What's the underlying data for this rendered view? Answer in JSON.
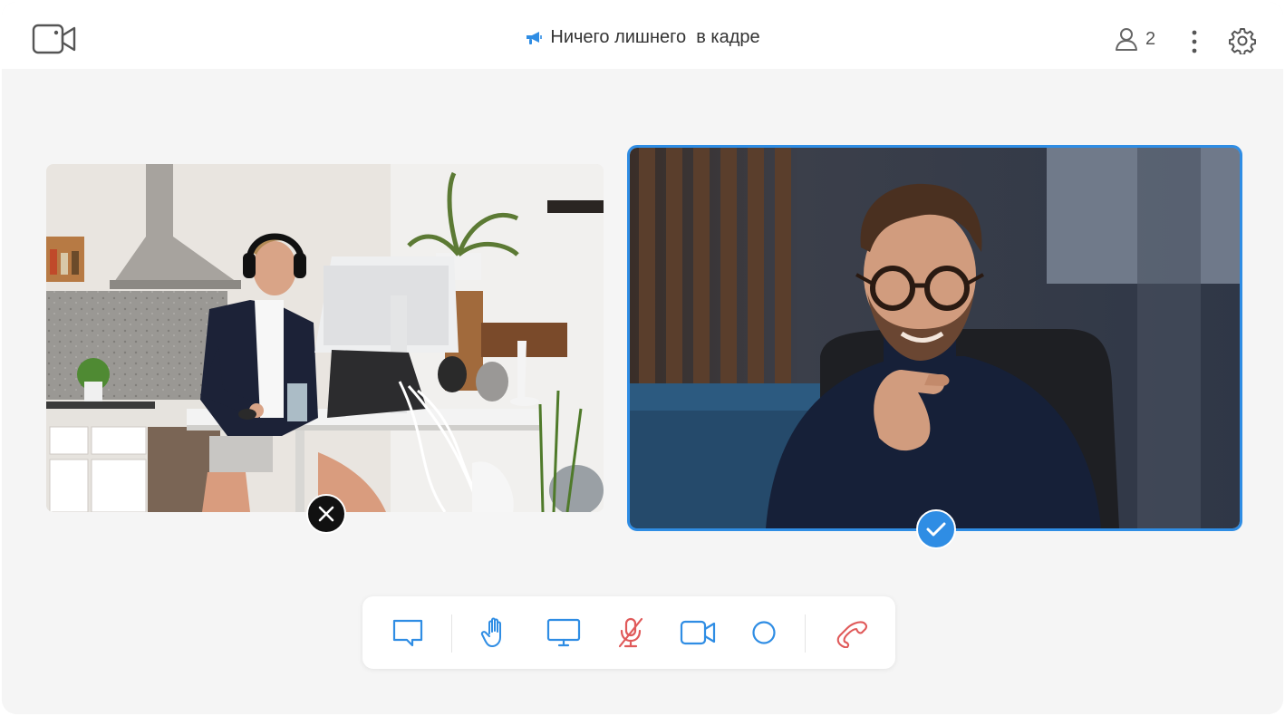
{
  "header": {
    "camera_icon": "video-camera-icon",
    "title": "Ничего лишнего  в кадре",
    "title_icon": "megaphone-icon",
    "participants_count": "2",
    "more_icon": "more-vertical-icon",
    "settings_icon": "gear-icon"
  },
  "tiles": [
    {
      "name": "participant-home-office",
      "status": "rejected",
      "status_icon": "close-icon"
    },
    {
      "name": "participant-turtleneck",
      "status": "approved",
      "status_icon": "check-icon",
      "highlighted": true
    }
  ],
  "toolbar": {
    "buttons": [
      "chat-icon",
      "raise-hand-icon",
      "screen-share-icon",
      "microphone-muted-icon",
      "camera-icon",
      "record-icon",
      "hang-up-icon"
    ]
  },
  "colors": {
    "accent": "#2f8de4",
    "danger": "#e05a5a",
    "background": "#f5f5f5"
  }
}
